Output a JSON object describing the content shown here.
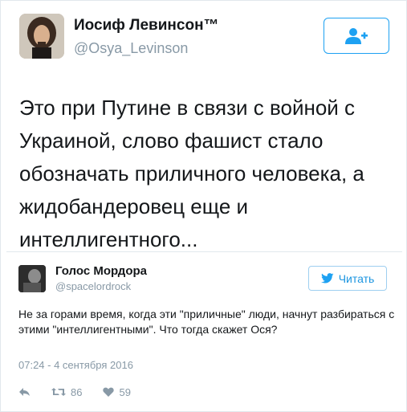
{
  "main_tweet": {
    "author_name": "Иосиф Левинсон™",
    "author_handle": "@Osya_Levinson",
    "text": "Это при Путине в связи с войной с Украиной, слово фашист стало обозначать приличного человека, а жидобандеровец еще и интеллигентного...",
    "follow_icon": "add-user-icon"
  },
  "quoted_tweet": {
    "author_name": "Голос Мордора",
    "author_handle": "@spacelordrock",
    "read_button_label": "Читать",
    "text": "Не за горами время, когда эти \"приличные\" люди, начнут разбираться с этими \"интеллигентными\". Что тогда скажет Ося?",
    "timestamp": "07:24 - 4 сентября 2016",
    "retweet_count": "86",
    "like_count": "59"
  },
  "colors": {
    "accent": "#1da1f2",
    "muted": "#8899a6",
    "text": "#14171a",
    "border": "#e1e8ed"
  }
}
